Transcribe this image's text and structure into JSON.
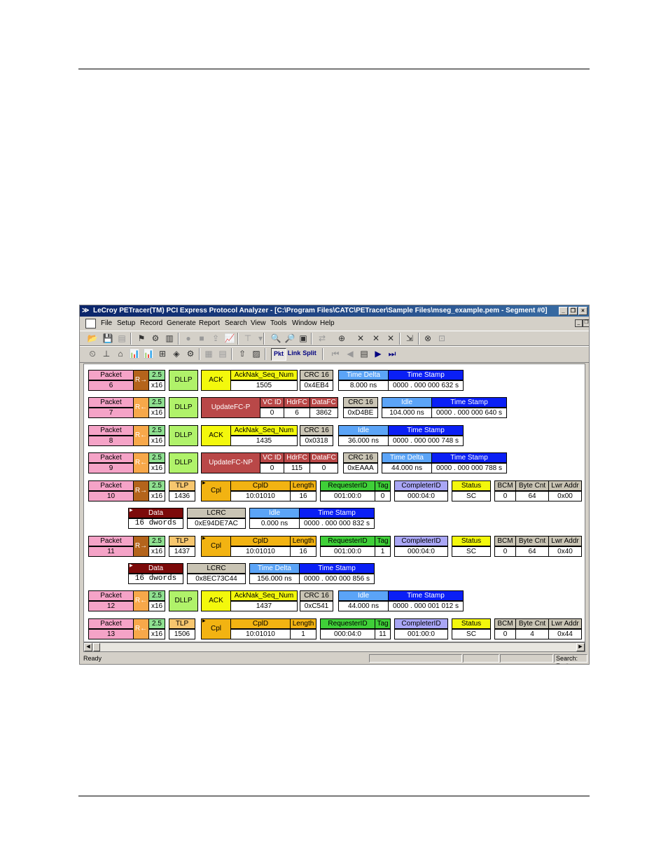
{
  "window": {
    "title": "LeCroy PETracer(TM) PCI Express Protocol Analyzer - [C:\\Program Files\\CATC\\PETracer\\Sample Files\\mseg_example.pem - Segment #0]",
    "minimize_glyph": "_",
    "restore_glyph": "❐",
    "close_glyph": "×"
  },
  "menu": [
    "File",
    "Setup",
    "Record",
    "Generate",
    "Report",
    "Search",
    "View",
    "Tools",
    "Window",
    "Help"
  ],
  "toolbar3": {
    "pkt": "Pkt",
    "link": "Link",
    "split": "Split"
  },
  "packets": [
    {
      "packet_label": "Packet",
      "num": "6",
      "dir": "R→",
      "speed": "2.5",
      "width": "x16",
      "type": "DLLP",
      "kind": "ACK",
      "ack_h": "AckNak_Seq_Num",
      "ack_v": "1505",
      "crc_h": "CRC 16",
      "crc_v": "0x4EB4",
      "td_h": "Time Delta",
      "td_v": "8.000 ns",
      "ts_h": "Time Stamp",
      "ts_v": "0000 . 000 000 632 s"
    },
    {
      "packet_label": "Packet",
      "num": "7",
      "dir": "R←",
      "speed": "2.5",
      "width": "x16",
      "type": "DLLP",
      "kind": "UpdateFC-P",
      "vc_h": "VC ID",
      "vc_v": "0",
      "hdr_h": "HdrFC",
      "hdr_v": "6",
      "data_h": "DataFC",
      "data_v": "3862",
      "crc_h": "CRC 16",
      "crc_v": "0xD4BE",
      "td_h": "Idle",
      "td_v": "104.000 ns",
      "ts_h": "Time Stamp",
      "ts_v": "0000 . 000 000 640 s"
    },
    {
      "packet_label": "Packet",
      "num": "8",
      "dir": "R←",
      "speed": "2.5",
      "width": "x16",
      "type": "DLLP",
      "kind": "ACK",
      "ack_h": "AckNak_Seq_Num",
      "ack_v": "1435",
      "crc_h": "CRC 16",
      "crc_v": "0x0318",
      "td_h": "Idle",
      "td_v": "36.000 ns",
      "ts_h": "Time Stamp",
      "ts_v": "0000 . 000 000 748 s"
    },
    {
      "packet_label": "Packet",
      "num": "9",
      "dir": "R←",
      "speed": "2.5",
      "width": "x16",
      "type": "DLLP",
      "kind": "UpdateFC-NP",
      "vc_h": "VC ID",
      "vc_v": "0",
      "hdr_h": "HdrFC",
      "hdr_v": "115",
      "data_h": "DataFC",
      "data_v": "0",
      "crc_h": "CRC 16",
      "crc_v": "0xEAAA",
      "td_h": "Time Delta",
      "td_v": "44.000 ns",
      "ts_h": "Time Stamp",
      "ts_v": "0000 . 000 000 788 s"
    },
    {
      "packet_label": "Packet",
      "num": "10",
      "dir": "R→",
      "speed": "2.5",
      "width": "x16",
      "type_h": "TLP",
      "type_v": "1436",
      "kind": "Cpl",
      "cplid_h": "CplD",
      "cplid_v": "10:01010",
      "len_h": "Length",
      "len_v": "16",
      "req_h": "RequesterID",
      "req_v": "001:00:0",
      "tag_h": "Tag",
      "tag_v": "0",
      "comp_h": "CompleterID",
      "comp_v": "000:04:0",
      "status_h": "Status",
      "status_v": "SC",
      "bcm_h": "BCM",
      "bcm_v": "0",
      "bc_h": "Byte Cnt",
      "bc_v": "64",
      "la_h": "Lwr Addr",
      "la_v": "0x00",
      "data_h": "Data",
      "data_v": "16 dwords",
      "lcrc_h": "LCRC",
      "lcrc_v": "0xE94DE7AC",
      "td_h": "Idle",
      "td_v": "0.000 ns",
      "ts_h": "Time Stamp",
      "ts_v": "0000 . 000 000 832 s"
    },
    {
      "packet_label": "Packet",
      "num": "11",
      "dir": "R→",
      "speed": "2.5",
      "width": "x16",
      "type_h": "TLP",
      "type_v": "1437",
      "kind": "Cpl",
      "cplid_h": "CplD",
      "cplid_v": "10:01010",
      "len_h": "Length",
      "len_v": "16",
      "req_h": "RequesterID",
      "req_v": "001:00:0",
      "tag_h": "Tag",
      "tag_v": "1",
      "comp_h": "CompleterID",
      "comp_v": "000:04:0",
      "status_h": "Status",
      "status_v": "SC",
      "bcm_h": "BCM",
      "bcm_v": "0",
      "bc_h": "Byte Cnt",
      "bc_v": "64",
      "la_h": "Lwr Addr",
      "la_v": "0x40",
      "data_h": "Data",
      "data_v": "16 dwords",
      "lcrc_h": "LCRC",
      "lcrc_v": "0x8EC73C44",
      "td_h": "Time Delta",
      "td_v": "156.000 ns",
      "ts_h": "Time Stamp",
      "ts_v": "0000 . 000 000 856 s"
    },
    {
      "packet_label": "Packet",
      "num": "12",
      "dir": "R←",
      "speed": "2.5",
      "width": "x16",
      "type": "DLLP",
      "kind": "ACK",
      "ack_h": "AckNak_Seq_Num",
      "ack_v": "1437",
      "crc_h": "CRC 16",
      "crc_v": "0xC541",
      "td_h": "Idle",
      "td_v": "44.000 ns",
      "ts_h": "Time Stamp",
      "ts_v": "0000 . 000 001 012 s"
    },
    {
      "packet_label": "Packet",
      "num": "13",
      "dir": "R←",
      "speed": "2.5",
      "width": "x16",
      "type_h": "TLP",
      "type_v": "1506",
      "kind": "Cpl",
      "cplid_h": "CplD",
      "cplid_v": "10:01010",
      "len_h": "Length",
      "len_v": "1",
      "req_h": "RequesterID",
      "req_v": "000:04:0",
      "tag_h": "Tag",
      "tag_v": "11",
      "comp_h": "CompleterID",
      "comp_v": "001:00:0",
      "status_h": "Status",
      "status_v": "SC",
      "bcm_h": "BCM",
      "bcm_v": "0",
      "bc_h": "Byte Cnt",
      "bc_v": "4",
      "la_h": "Lwr Addr",
      "la_v": "0x44"
    }
  ],
  "status": {
    "left": "Ready",
    "right": "Search: Fwd"
  },
  "colors": {
    "packet": "#f5a3c7",
    "dllp": "#b0f26a",
    "tlp": "#f7c66e",
    "ack": "#f3f80c",
    "updatefc": "#b94848",
    "idle": "#5ba4f7",
    "timestamp": "#0a1ff5",
    "data": "#7c0a0a"
  }
}
